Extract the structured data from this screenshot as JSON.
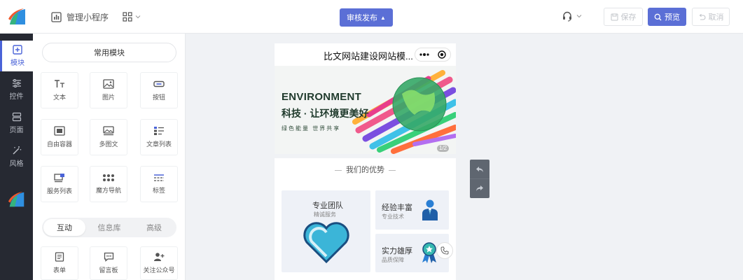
{
  "topbar": {
    "manage_label": "管理小程序",
    "publish_label": "审核发布",
    "save_label": "保存",
    "preview_label": "预览",
    "undo_label": "取消"
  },
  "rail": {
    "items": [
      {
        "label": "模块",
        "icon": "plus-square-icon",
        "active": true
      },
      {
        "label": "控件",
        "icon": "sliders-icon"
      },
      {
        "label": "页面",
        "icon": "pages-icon"
      },
      {
        "label": "风格",
        "icon": "magic-wand-icon"
      }
    ]
  },
  "panel": {
    "header": "常用模块",
    "common_tiles": [
      {
        "label": "文本",
        "icon": "text-icon"
      },
      {
        "label": "图片",
        "icon": "image-icon"
      },
      {
        "label": "按钮",
        "icon": "button-icon"
      },
      {
        "label": "自由容器",
        "icon": "container-icon"
      },
      {
        "label": "多图文",
        "icon": "multi-image-icon"
      },
      {
        "label": "文章列表",
        "icon": "article-list-icon"
      },
      {
        "label": "服务列表",
        "icon": "service-list-icon"
      },
      {
        "label": "魔方导航",
        "icon": "grid-nav-icon"
      },
      {
        "label": "标签",
        "icon": "tag-icon"
      }
    ],
    "tabs": [
      {
        "label": "互动",
        "active": true
      },
      {
        "label": "信息库"
      },
      {
        "label": "高级"
      }
    ],
    "interactive_tiles": [
      {
        "label": "表单",
        "icon": "form-icon"
      },
      {
        "label": "留言板",
        "icon": "message-icon"
      },
      {
        "label": "关注公众号",
        "icon": "follow-icon"
      }
    ]
  },
  "phone": {
    "title": "比文网站建设网站模...",
    "banner": {
      "en": "ENVIRONMENT",
      "cn": "科技 · 让环境更美好",
      "sub": "绿色能量 世界共享",
      "pager": "1/2"
    },
    "section_title": "我们的优势",
    "cards": [
      {
        "title": "专业团队",
        "sub": "精诚服务"
      },
      {
        "title": "经验丰富",
        "sub": "专业技术"
      },
      {
        "title": "实力雄厚",
        "sub": "品质保障"
      }
    ]
  },
  "colors": {
    "primary": "#5b6fd6",
    "rail_bg": "#262932",
    "active": "#4a63d8"
  }
}
